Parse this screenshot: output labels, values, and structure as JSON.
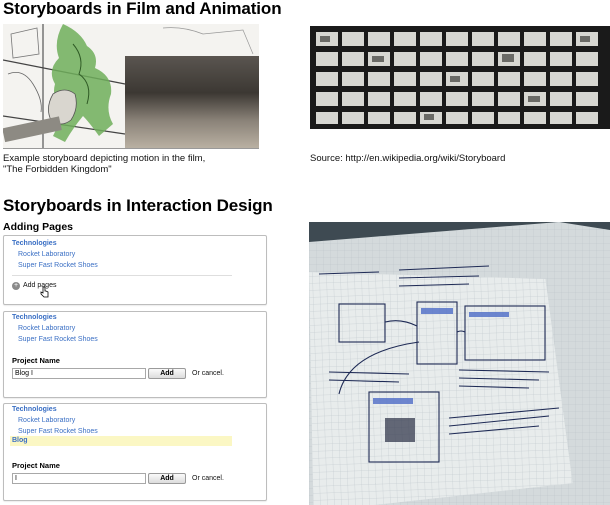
{
  "film_section": {
    "heading": "Storyboards in Film and Animation",
    "caption_line1": "Example storyboard depicting motion in the film,",
    "caption_line2": "\"The Forbidden Kingdom\"",
    "source": "Source: http://en.wikipedia.org/wiki/Storyboard"
  },
  "interaction_section": {
    "heading": "Storyboards in Interaction Design",
    "subheading": "Adding Pages"
  },
  "mockup": {
    "panel1": {
      "parent": "Technologies",
      "children": [
        "Rocket Laboratory",
        "Super Fast Rocket Shoes"
      ],
      "add_label": "Add pages"
    },
    "panel2": {
      "parent": "Technologies",
      "children": [
        "Rocket Laboratory",
        "Super Fast Rocket Shoes"
      ],
      "field_label": "Project Name",
      "field_value": "Blog",
      "button": "Add",
      "cancel": "Or cancel."
    },
    "panel3": {
      "parent": "Technologies",
      "children": [
        "Rocket Laboratory",
        "Super Fast Rocket Shoes"
      ],
      "new_item": "Blog",
      "field_label": "Project Name",
      "field_value": "",
      "button": "Add",
      "cancel": "Or cancel."
    }
  },
  "colors": {
    "link": "#3a6fc4",
    "highlight": "#fbf7c4",
    "film_green": "#6fae5a"
  }
}
